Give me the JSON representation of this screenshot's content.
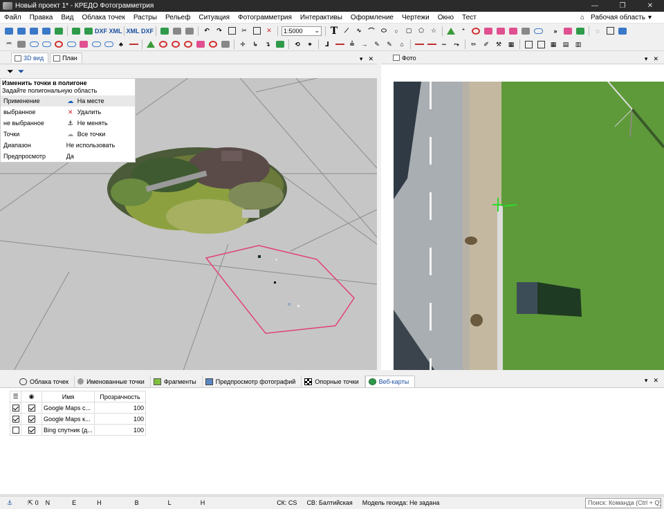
{
  "window": {
    "title": "Новый проект 1* - КРЕДО Фотограмметрия",
    "minimize": "—",
    "maximize": "❐",
    "close": "✕"
  },
  "menu": {
    "items": [
      "Файл",
      "Правка",
      "Вид",
      "Облака точек",
      "Растры",
      "Рельеф",
      "Ситуация",
      "Фотограмметрия",
      "Интерактивы",
      "Оформление",
      "Чертежи",
      "Окно",
      "Тест"
    ],
    "workspace": "Рабочая область",
    "workspace_arrow": "▾"
  },
  "toolbar": {
    "dxf1": "DXF",
    "xml1": "XML",
    "xml2": "XML",
    "dxf2": "DXF",
    "scale": "1:5000",
    "text_tool": "T",
    "more": "»"
  },
  "left_panel": {
    "tabs": [
      {
        "label": "3D вид",
        "active": true
      },
      {
        "label": "План",
        "active": false
      }
    ],
    "pin": "▾",
    "close": "✕"
  },
  "props": {
    "title": "Изменить точки в полигоне",
    "hint": "Задайте полигональную область",
    "rows": [
      {
        "label": "Применение",
        "symbol": "☁",
        "value": "На месте",
        "color": "#1a5fc0"
      },
      {
        "label": "выбранное",
        "symbol": "✕",
        "value": "Удалить",
        "color": "#d02020"
      },
      {
        "label": "не выбранное",
        "symbol": "⚓",
        "value": "Не менять",
        "color": "#000000"
      },
      {
        "label": "Точки",
        "symbol": "☁",
        "value": "Все точки",
        "color": "#999999"
      },
      {
        "label": "Диапазон",
        "symbol": "",
        "value": "Не использовать",
        "color": "#000000"
      },
      {
        "label": "Предпросмотр",
        "symbol": "",
        "value": "Да",
        "color": "#000000"
      }
    ]
  },
  "right_panel": {
    "tab": "Фото",
    "pin": "▾",
    "close": "✕"
  },
  "bottom_tabs": [
    {
      "label": "Облака точек",
      "icon": "cloud-icon",
      "active": false
    },
    {
      "label": "Именованные точки",
      "icon": "dot-icon",
      "active": false
    },
    {
      "label": "Фрагменты",
      "icon": "fragment-icon",
      "active": false
    },
    {
      "label": "Предпросмотр фотографий",
      "icon": "photo-preview-icon",
      "active": false
    },
    {
      "label": "Опорные точки",
      "icon": "checker-icon",
      "active": false
    },
    {
      "label": "Веб-карты",
      "icon": "globe-icon",
      "active": true
    }
  ],
  "bottom_ctrls": {
    "pin": "▾",
    "close": "✕"
  },
  "layers": {
    "columns": {
      "visible_icon": "layers-icon",
      "eye_icon": "eye-icon",
      "name": "Имя",
      "opacity": "Прозрачность"
    },
    "rows": [
      {
        "layer": true,
        "visible": true,
        "name": "Google Maps с...",
        "opacity": "100"
      },
      {
        "layer": true,
        "visible": true,
        "name": "Google Maps к...",
        "opacity": "100"
      },
      {
        "layer": false,
        "visible": true,
        "name": "Bing спутник (д...",
        "opacity": "100"
      }
    ]
  },
  "status": {
    "count": "0",
    "n": "N",
    "e": "E",
    "h": "H",
    "b": "B",
    "l": "L",
    "h2": "H",
    "sk": "СК:  CS",
    "sv": "СВ:  Балтийская",
    "geoid": "Модель геоида:  Не задана",
    "search_placeholder": "Поиск: Команда (Ctrl + Q)"
  },
  "colors": {
    "accent": "#1a4fa0",
    "polygon": "#e0407a",
    "ground": "#c6c6c6"
  }
}
